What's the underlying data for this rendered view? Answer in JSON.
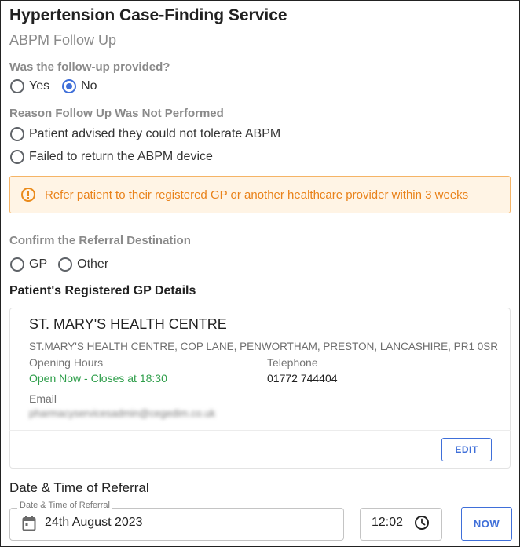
{
  "header": {
    "title": "Hypertension Case-Finding Service",
    "subtitle": "ABPM Follow Up"
  },
  "followup": {
    "question": "Was the follow-up provided?",
    "options": [
      {
        "label": "Yes",
        "selected": false
      },
      {
        "label": "No",
        "selected": true
      }
    ]
  },
  "reason": {
    "question": "Reason Follow Up Was Not Performed",
    "options": [
      {
        "label": "Patient advised they could not tolerate ABPM",
        "selected": false
      },
      {
        "label": "Failed to return the ABPM device",
        "selected": false
      }
    ]
  },
  "alert": {
    "icon": "warning-circle-icon",
    "text": "Refer patient to their registered GP or another healthcare provider within 3 weeks",
    "color": "#e9821a"
  },
  "referral": {
    "question": "Confirm the Referral Destination",
    "options": [
      {
        "label": "GP",
        "selected": false
      },
      {
        "label": "Other",
        "selected": false
      }
    ]
  },
  "gp_details": {
    "heading": "Patient's Registered GP Details",
    "name": "ST. MARY'S HEALTH CENTRE",
    "address": "ST.MARY'S HEALTH CENTRE, COP LANE, PENWORTHAM, PRESTON, LANCASHIRE, PR1 0SR",
    "opening_hours_label": "Opening Hours",
    "opening_status": "Open Now - Closes at 18:30",
    "telephone_label": "Telephone",
    "telephone": "01772 744404",
    "email_label": "Email",
    "email": "pharmacyservicesadmin@cegedim.co.uk",
    "edit_label": "EDIT"
  },
  "datetime": {
    "heading": "Date & Time of Referral",
    "field_label": "Date & Time of Referral",
    "date": "24th August 2023",
    "time": "12:02",
    "now_label": "NOW"
  },
  "colors": {
    "accent": "#3f6fd9",
    "open_status": "#2e9e4a",
    "warning_bg": "#fff4e5"
  }
}
